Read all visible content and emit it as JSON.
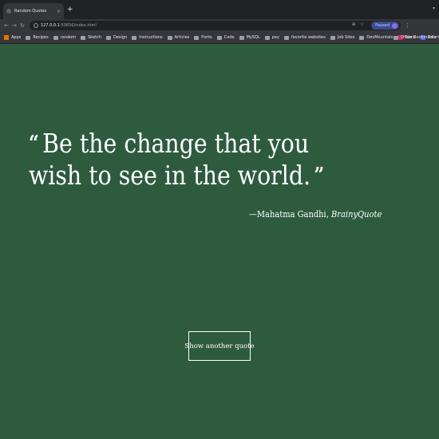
{
  "browser": {
    "tab": {
      "title": "Random Quotes",
      "close": "×"
    },
    "new_tab": "+",
    "toolbar": {
      "back": "←",
      "forward": "→",
      "reload": "↻",
      "url_host": "127.0.0.1",
      "url_rest": ":50656/index.html",
      "zoom_icon": "⊕",
      "star_icon": "☆",
      "profile_label": "Paused",
      "menu": "⋮"
    },
    "bookmarks": [
      {
        "label": "Apps",
        "icon": "apps-grid-icon"
      },
      {
        "label": "Recipes",
        "icon": "folder-icon"
      },
      {
        "label": "random",
        "icon": "folder-icon"
      },
      {
        "label": "Sketch",
        "icon": "folder-icon"
      },
      {
        "label": "Design",
        "icon": "folder-icon"
      },
      {
        "label": "Instructions",
        "icon": "folder-icon"
      },
      {
        "label": "Articles",
        "icon": "folder-icon"
      },
      {
        "label": "Fonts",
        "icon": "folder-icon"
      },
      {
        "label": "Code",
        "icon": "folder-icon"
      },
      {
        "label": "MySQL",
        "icon": "folder-icon"
      },
      {
        "label": "pay",
        "icon": "folder-icon"
      },
      {
        "label": "favorite websites",
        "icon": "folder-icon"
      },
      {
        "label": "Job Sites",
        "icon": "folder-icon"
      },
      {
        "label": "DevMountain",
        "icon": "folder-icon"
      },
      {
        "label": "Slack",
        "icon": "slack-icon"
      },
      {
        "label": "Tutoring",
        "icon": "tutoring-icon"
      }
    ],
    "bookmarks_more": "»",
    "other_bookmarks": "Other Bookmarks"
  },
  "page": {
    "quote_open_mark": "“",
    "quote_text": "Be the change that you wish to see in the world.",
    "quote_close_mark": "”",
    "attribution_author": "—Mahatma Gandhi, ",
    "attribution_source": "BrainyQuote",
    "button_label": "Show another quote"
  },
  "colors": {
    "page_background": "#2e5b3e",
    "text": "#ffffff",
    "browser_chrome": "#35363a"
  }
}
